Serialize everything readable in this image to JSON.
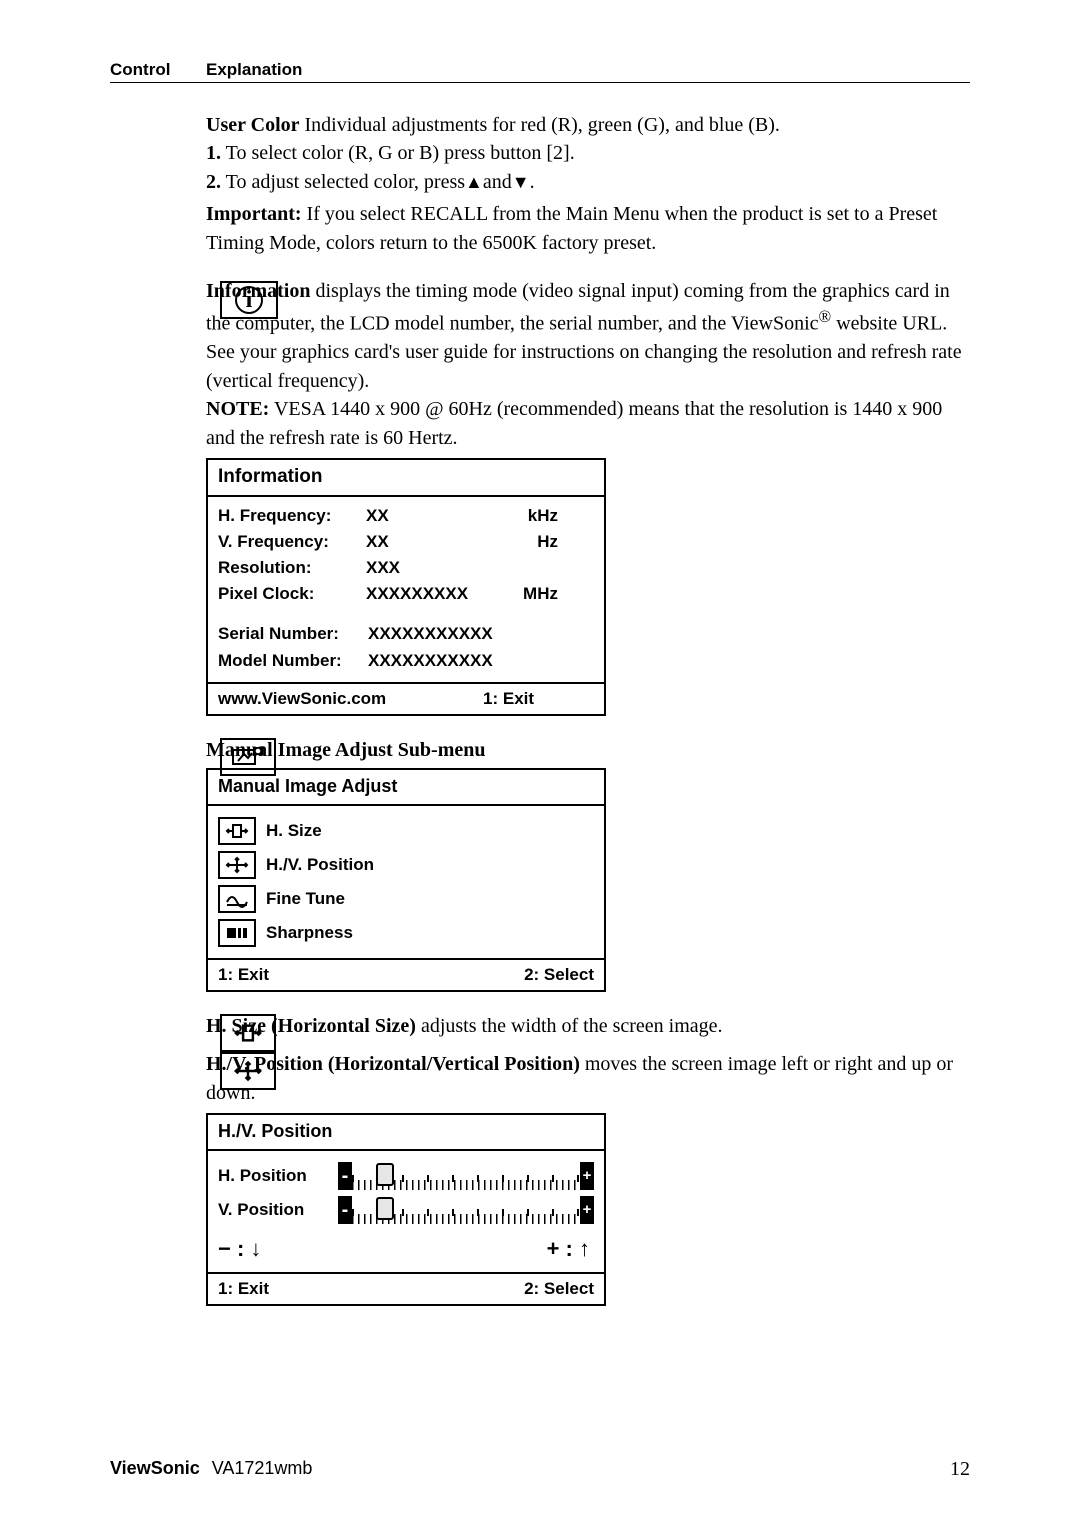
{
  "header": {
    "control": "Control",
    "explanation": "Explanation"
  },
  "userColor": {
    "title": "User Color",
    "rest": "  Individual adjustments for red (R), green (G),  and blue (B).",
    "step1_bold": "1.",
    "step1": "  To select color (R, G or B) press button [2].",
    "step2_bold": "2.",
    "step2a": "  To adjust selected color, press",
    "step2b": "and",
    "step2c": ".",
    "important_bold": "Important:",
    "important_rest": " If you select RECALL from the Main Menu when the product is set to a Preset Timing Mode, colors return to the 6500K factory preset."
  },
  "information": {
    "title": "Information",
    "rest1": " displays the timing mode (video signal input) coming from the graphics card in the computer, the LCD model number, the serial number, and the ViewSonic",
    "rest2": " website URL. See your graphics card's user guide for instructions on changing the resolution and refresh rate (vertical frequency).",
    "note_bold": "NOTE:",
    "note_rest": " VESA 1440 x 900 @ 60Hz (recommended) means that the resolution is 1440 x 900 and the refresh rate is 60 Hertz.",
    "box": {
      "title": "Information",
      "rows": [
        {
          "label": "H. Frequency:",
          "value": "XX",
          "unit": "kHz"
        },
        {
          "label": "V. Frequency:",
          "value": "XX",
          "unit": "Hz"
        },
        {
          "label": "Resolution:",
          "value": "XXX",
          "unit": ""
        },
        {
          "label": "Pixel Clock:",
          "value": "XXXXXXXXX",
          "unit": "MHz"
        }
      ],
      "serial_label": "Serial Number:",
      "serial_value": "XXXXXXXXXXX",
      "model_label": "Model Number:",
      "model_value": "XXXXXXXXXXX",
      "footer_url": "www.ViewSonic.com",
      "footer_exit": "1: Exit"
    }
  },
  "mia": {
    "heading": "Manual Image Adjust Sub-menu",
    "box": {
      "title": "Manual Image Adjust",
      "items": [
        "H. Size",
        "H./V. Position",
        "Fine Tune",
        "Sharpness"
      ],
      "exit": "1: Exit",
      "select": "2: Select"
    }
  },
  "hsize": {
    "title": "H. Size (Horizontal Size)",
    "rest": " adjusts the width of the screen image."
  },
  "hvpos": {
    "title": "H./V. Position (Horizontal/Vertical Position)",
    "rest": " moves the screen image left or right and up or down.",
    "box": {
      "title": "H./V. Position",
      "h": "H. Position",
      "v": "V. Position",
      "minus": "− : ",
      "plus": "+ : ",
      "exit": "1: Exit",
      "select": "2: Select"
    }
  },
  "footer": {
    "brand": "ViewSonic",
    "model": "VA1721wmb",
    "page": "12"
  },
  "reg": "®"
}
